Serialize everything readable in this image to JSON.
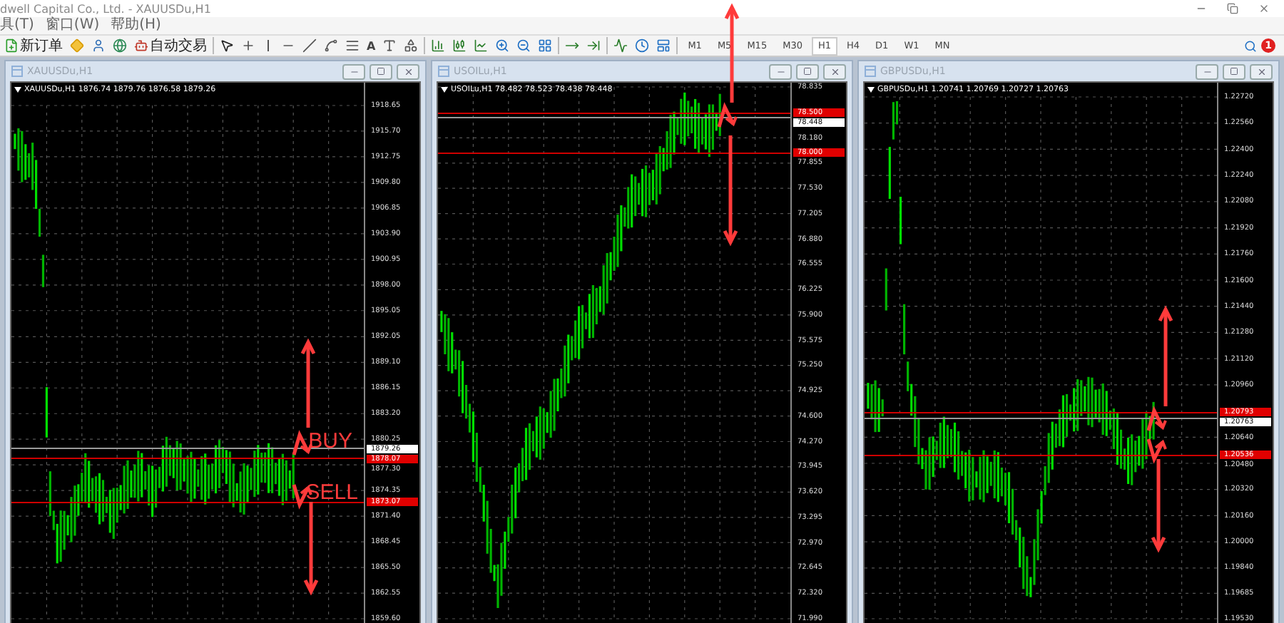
{
  "window": {
    "title": "dwell Capital Co., Ltd. - XAUUSDu,H1"
  },
  "menu": [
    {
      "label": "具(T)"
    },
    {
      "label": "窗口(W)"
    },
    {
      "label": "帮助(H)"
    }
  ],
  "toolbar": {
    "tools": [
      {
        "kind": "new-order",
        "label": "新订单"
      },
      {
        "kind": "diamond"
      },
      {
        "kind": "navigator"
      },
      {
        "kind": "globe"
      },
      {
        "kind": "auto-trading",
        "label": "自动交易"
      },
      {
        "kind": "separator"
      },
      {
        "kind": "cursor"
      },
      {
        "kind": "crosshair"
      },
      {
        "kind": "vline"
      },
      {
        "kind": "hline"
      },
      {
        "kind": "trend"
      },
      {
        "kind": "fib"
      },
      {
        "kind": "channel"
      },
      {
        "kind": "text",
        "glyph": "A"
      },
      {
        "kind": "label"
      },
      {
        "kind": "shapes"
      },
      {
        "kind": "separator"
      },
      {
        "kind": "bars"
      },
      {
        "kind": "candles"
      },
      {
        "kind": "line"
      },
      {
        "kind": "zoom-in"
      },
      {
        "kind": "zoom-out"
      },
      {
        "kind": "tile"
      },
      {
        "kind": "separator"
      },
      {
        "kind": "autoscroll"
      },
      {
        "kind": "shift"
      },
      {
        "kind": "separator"
      },
      {
        "kind": "indicators"
      },
      {
        "kind": "periods"
      },
      {
        "kind": "templates"
      },
      {
        "kind": "separator"
      }
    ],
    "timeframes": [
      {
        "label": "M1",
        "selected": false
      },
      {
        "label": "M5",
        "selected": false
      },
      {
        "label": "M15",
        "selected": false
      },
      {
        "label": "M30",
        "selected": false
      },
      {
        "label": "H1",
        "selected": true
      },
      {
        "label": "H4",
        "selected": false
      },
      {
        "label": "D1",
        "selected": false
      },
      {
        "label": "W1",
        "selected": false
      },
      {
        "label": "MN",
        "selected": false
      }
    ],
    "notification_count": "1"
  },
  "charts": [
    {
      "title": "XAUUSDu,H1",
      "info": "XAUUSDu,H1 1876.74 1879.76 1876.58 1879.26",
      "ticks": [
        "1918.65",
        "1915.70",
        "1912.75",
        "1909.80",
        "1906.85",
        "1903.90",
        "1900.95",
        "1898.00",
        "1895.05",
        "1892.05",
        "1889.10",
        "1886.15",
        "1883.20",
        "1880.25",
        "1877.30",
        "1874.35",
        "1871.40",
        "1868.45",
        "1865.50",
        "1862.55",
        "1859.60"
      ],
      "tags": [
        {
          "value": "1879.26",
          "kind": "bid"
        },
        {
          "value": "1878.07",
          "kind": "order"
        },
        {
          "value": "1873.07",
          "kind": "order"
        }
      ],
      "annotations": [
        {
          "text": "BUY"
        },
        {
          "text": "SELL"
        }
      ]
    },
    {
      "title": "USOILu,H1",
      "info": "USOILu,H1 78.482 78.523 78.438 78.448",
      "ticks": [
        "78.835",
        "78.180",
        "77.855",
        "77.530",
        "77.205",
        "76.880",
        "76.555",
        "76.225",
        "75.900",
        "75.575",
        "75.250",
        "74.925",
        "74.600",
        "74.270",
        "73.945",
        "73.620",
        "73.295",
        "72.970",
        "72.645",
        "72.320",
        "71.990"
      ],
      "tags": [
        {
          "value": "78.500",
          "kind": "order"
        },
        {
          "value": "78.448",
          "kind": "bid"
        },
        {
          "value": "78.000",
          "kind": "order"
        }
      ]
    },
    {
      "title": "GBPUSDu,H1",
      "info": "GBPUSDu,H1 1.20741 1.20769 1.20727 1.20763",
      "ticks": [
        "1.22720",
        "1.22560",
        "1.22400",
        "1.22240",
        "1.22080",
        "1.21920",
        "1.21760",
        "1.21600",
        "1.21440",
        "1.21280",
        "1.21120",
        "1.20960",
        "1.20640",
        "1.20480",
        "1.20320",
        "1.20160",
        "1.20000",
        "1.19840",
        "1.19685",
        "1.19530"
      ],
      "tags": [
        {
          "value": "1.20793",
          "kind": "order"
        },
        {
          "value": "1.20763",
          "kind": "bid"
        },
        {
          "value": "1.20536",
          "kind": "order"
        }
      ]
    }
  ]
}
